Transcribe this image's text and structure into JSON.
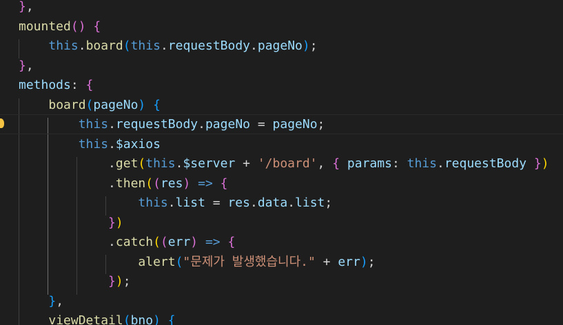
{
  "editor": {
    "theme": "dark",
    "background": "#1e1e1e",
    "gutter_icon": "lightbulb-icon",
    "lines": [
      "},",
      "mounted() {",
      "    this.board(this.requestBody.pageNo);",
      "},",
      "methods: {",
      "    board(pageNo) {",
      "        this.requestBody.pageNo = pageNo;",
      "        this.$axios",
      "            .get(this.$server + '/board', { params: this.requestBody })",
      "            .then((res) => {",
      "                this.list = res.data.list;",
      "            })",
      "            .catch((err) => {",
      "                alert(\"문제가 발생했습니다.\" + err);",
      "            });",
      "    },",
      "    viewDetail(bno) {"
    ]
  }
}
